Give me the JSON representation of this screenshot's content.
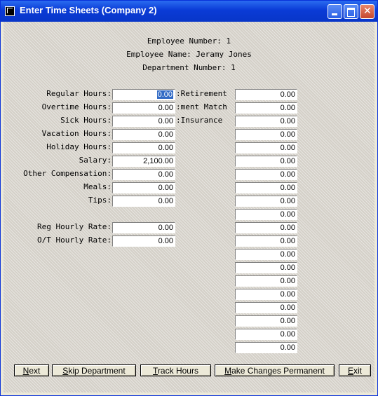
{
  "window": {
    "title": "Enter Time Sheets (Company 2)"
  },
  "header": {
    "employee_number": "Employee Number: 1",
    "employee_name": "Employee Name: Jeramy Jones",
    "department_number": "Department Number: 1"
  },
  "left_fields": [
    {
      "label": "Regular Hours:",
      "value": "0.00"
    },
    {
      "label": "Overtime Hours:",
      "value": "0.00"
    },
    {
      "label": "Sick Hours:",
      "value": "0.00"
    },
    {
      "label": "Vacation Hours:",
      "value": "0.00"
    },
    {
      "label": "Holiday Hours:",
      "value": "0.00"
    },
    {
      "label": "Salary:",
      "value": "2,100.00"
    },
    {
      "label": "Other Compensation:",
      "value": "0.00"
    },
    {
      "label": "Meals:",
      "value": "0.00"
    },
    {
      "label": "Tips:",
      "value": "0.00"
    }
  ],
  "rate_fields": [
    {
      "label": "Reg Hourly Rate:",
      "value": "0.00"
    },
    {
      "label": "O/T Hourly Rate:",
      "value": "0.00"
    }
  ],
  "right_labels": [
    "Retirement:",
    "ment Match:",
    "Insurance:"
  ],
  "right_values": [
    "0.00",
    "0.00",
    "0.00",
    "0.00",
    "0.00",
    "0.00",
    "0.00",
    "0.00",
    "0.00",
    "0.00",
    "0.00",
    "0.00",
    "0.00",
    "0.00",
    "0.00",
    "0.00",
    "0.00",
    "0.00",
    "0.00",
    "0.00"
  ],
  "buttons": [
    {
      "mnemonic": "N",
      "rest": "ext"
    },
    {
      "mnemonic": "S",
      "rest": "kip Department"
    },
    {
      "mnemonic": "T",
      "rest": "rack Hours"
    },
    {
      "mnemonic": "M",
      "rest": "ake Changes Permanent"
    },
    {
      "mnemonic": "E",
      "rest": "xit"
    }
  ]
}
